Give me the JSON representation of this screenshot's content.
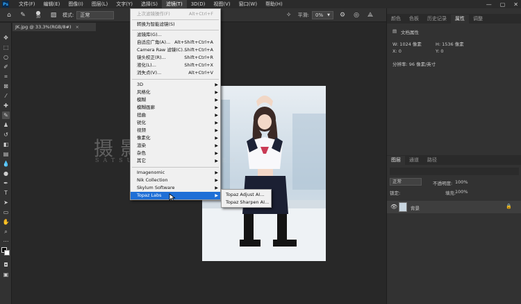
{
  "app": {
    "logo": "Ps"
  },
  "menubar": {
    "items": [
      "文件(F)",
      "编辑(E)",
      "图像(I)",
      "图层(L)",
      "文字(Y)",
      "选择(S)",
      "滤镜(T)",
      "3D(D)",
      "视图(V)",
      "窗口(W)",
      "帮助(H)"
    ],
    "active": "滤镜(T)",
    "window_controls": [
      "minimize-icon",
      "maximize-icon",
      "close-icon"
    ]
  },
  "options_bar": {
    "brush_size": "30",
    "mode_label": "模式:",
    "mode_value": "正常",
    "smoothing_label": "平滑:",
    "smoothing_value": "0%"
  },
  "document_tab": {
    "title": "JK.jpg @ 33.3%(RGB/8#)",
    "close": "×"
  },
  "filter_menu": {
    "items": [
      {
        "label": "上次滤镜操作(F)",
        "shortcut": "Alt+Ctrl+F",
        "disabled": true
      },
      {
        "label": "转换为智能滤镜(S)"
      },
      {
        "label": "滤镜库(G)..."
      },
      {
        "label": "自适应广角(A)...",
        "shortcut": "Alt+Shift+Ctrl+A"
      },
      {
        "label": "Camera Raw 滤镜(C)...",
        "shortcut": "Shift+Ctrl+A"
      },
      {
        "label": "镜头校正(R)...",
        "shortcut": "Shift+Ctrl+R"
      },
      {
        "label": "液化(L)...",
        "shortcut": "Shift+Ctrl+X"
      },
      {
        "label": "消失点(V)...",
        "shortcut": "Alt+Ctrl+V"
      },
      {
        "label": "3D",
        "submenu": true
      },
      {
        "label": "风格化",
        "submenu": true
      },
      {
        "label": "模糊",
        "submenu": true
      },
      {
        "label": "模糊画廊",
        "submenu": true
      },
      {
        "label": "扭曲",
        "submenu": true
      },
      {
        "label": "锐化",
        "submenu": true
      },
      {
        "label": "视频",
        "submenu": true
      },
      {
        "label": "像素化",
        "submenu": true
      },
      {
        "label": "渲染",
        "submenu": true
      },
      {
        "label": "杂色",
        "submenu": true
      },
      {
        "label": "其它",
        "submenu": true
      },
      {
        "label": "Imagenomic",
        "submenu": true
      },
      {
        "label": "Nik Collection",
        "submenu": true
      },
      {
        "label": "Skylum Software",
        "submenu": true
      },
      {
        "label": "Topaz Labs",
        "submenu": true,
        "highlighted": true
      }
    ]
  },
  "topaz_submenu": {
    "items": [
      "Topaz Adjust AI...",
      "Topaz Sharpen AI..."
    ]
  },
  "watermark": {
    "text": "摄影新干线",
    "subtext": "SATSUEI SHINKANSEN"
  },
  "properties_panel": {
    "tabs": [
      "颜色",
      "色板",
      "历史记录",
      "属性",
      "调整"
    ],
    "active_tab": "属性",
    "section_title": "文档属性",
    "width": "W: 1024 像素",
    "height": "H: 1536 像素",
    "x": "X: 0",
    "y": "Y: 0",
    "resolution": "分辨率: 96 像素/英寸"
  },
  "layers_panel": {
    "tabs": [
      "图层",
      "通道",
      "路径"
    ],
    "active_tab": "图层",
    "blend_mode": "正常",
    "opacity_label": "不透明度:",
    "opacity": "100%",
    "lock_label": "锁定:",
    "fill_label": "填充:",
    "fill": "100%",
    "layer_name": "背景"
  },
  "colors": {
    "menu_highlight": "#1f6fd6",
    "ps_blue": "#31a8ff"
  }
}
